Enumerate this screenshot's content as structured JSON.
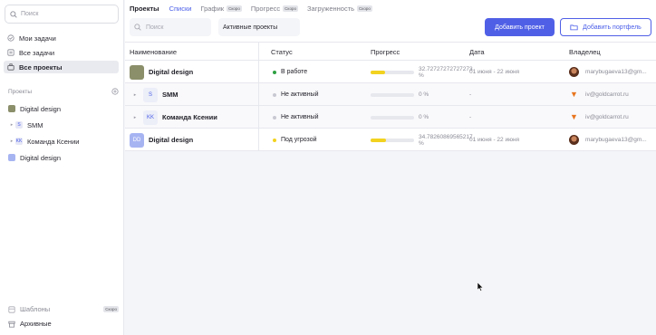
{
  "sidebar": {
    "search_placeholder": "Поиск",
    "nav": [
      {
        "label": "Мои задачи",
        "icon": "check-circle-icon"
      },
      {
        "label": "Все задачи",
        "icon": "list-icon"
      },
      {
        "label": "Все проекты",
        "icon": "briefcase-icon",
        "active": true
      }
    ],
    "projects_header": "Проекты",
    "projects": [
      {
        "label": "Digital design",
        "avatar": "",
        "avatar_color": "#8b8f6a"
      },
      {
        "label": "SMM",
        "avatar": "S",
        "avatar_color": "#e6e7f6"
      },
      {
        "label": "Команда Ксении",
        "avatar": "KK",
        "avatar_color": "#e6e7f6"
      },
      {
        "label": "Digital design",
        "avatar": "DD",
        "avatar_color": "#a7b4f2"
      }
    ],
    "templates": {
      "label": "Шаблоны",
      "badge": "Скоро"
    },
    "archive": {
      "label": "Архивные"
    }
  },
  "topbar": {
    "title": "Проекты",
    "tabs": [
      {
        "label": "Списки",
        "active": true
      },
      {
        "label": "График",
        "badge": "Скоро"
      },
      {
        "label": "Прогресс",
        "badge": "Скоро"
      },
      {
        "label": "Загруженность",
        "badge": "Скоро"
      }
    ],
    "search_placeholder": "Поиск",
    "filter_value": "Активные проекты",
    "add_project": "Добавить проект",
    "add_portfolio": "Добавить портфель"
  },
  "table": {
    "columns": [
      "Наименование",
      "Статус",
      "Прогресс",
      "Дата",
      "Владелец"
    ],
    "rows": [
      {
        "name": "Digital design",
        "avatar": "",
        "avatar_color": "#8b8f6a",
        "expandable": false,
        "status": "В работе",
        "status_color": "#2ea043",
        "progress": 0.327,
        "progress_text": "32.72727272727273 %",
        "date": "01 июня - 22 июня",
        "owner": "marybugaeva13@gm...",
        "owner_type": "photo"
      },
      {
        "name": "SMM",
        "avatar": "S",
        "avatar_color": "#eceef8",
        "expandable": true,
        "status": "Не активный",
        "status_color": "#c8c9d2",
        "progress": 0,
        "progress_text": "0 %",
        "date": "-",
        "owner": "iv@goldcarrot.ru",
        "owner_type": "carrot"
      },
      {
        "name": "Команда Ксении",
        "avatar": "KK",
        "avatar_color": "#eceef8",
        "expandable": true,
        "status": "Не активный",
        "status_color": "#c8c9d2",
        "progress": 0,
        "progress_text": "0 %",
        "date": "-",
        "owner": "iv@goldcarrot.ru",
        "owner_type": "carrot"
      },
      {
        "name": "Digital design",
        "avatar": "DD",
        "avatar_color": "#a7b4f2",
        "expandable": false,
        "status": "Под угрозой",
        "status_color": "#f2d21f",
        "progress": 0.348,
        "progress_text": "34.78260869565217 %",
        "date": "01 июня - 22 июня",
        "owner": "marybugaeva13@gm...",
        "owner_type": "photo"
      }
    ]
  }
}
